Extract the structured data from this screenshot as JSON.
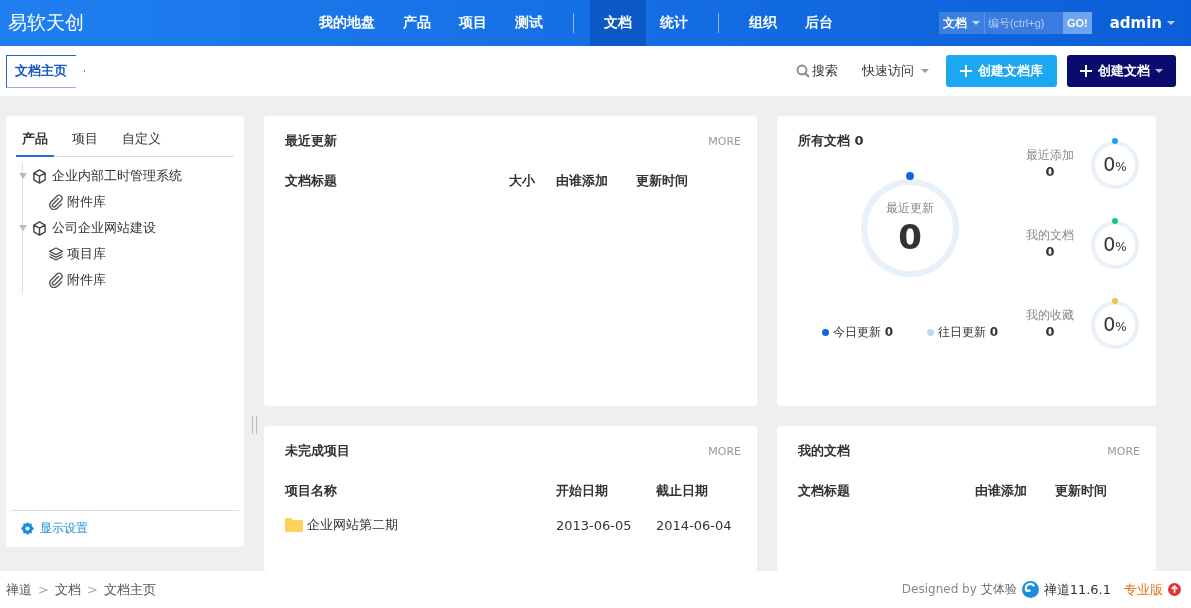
{
  "header": {
    "brand": "易软天创",
    "nav_groups": [
      {
        "items": [
          {
            "label": "我的地盘",
            "selected": false
          },
          {
            "label": "产品",
            "selected": false
          },
          {
            "label": "项目",
            "selected": false
          },
          {
            "label": "测试",
            "selected": false
          }
        ]
      },
      {
        "items": [
          {
            "label": "文档",
            "selected": true
          },
          {
            "label": "统计",
            "selected": false
          }
        ]
      },
      {
        "items": [
          {
            "label": "组织",
            "selected": false
          },
          {
            "label": "后台",
            "selected": false
          }
        ]
      }
    ],
    "search": {
      "type_label": "文档",
      "placeholder": "编号(ctrl+g)",
      "go": "GO!"
    },
    "user": "admin"
  },
  "toolbar": {
    "breadcrumb": "文档主页",
    "search": "搜索",
    "quick_access": "快速访问",
    "buttons": [
      {
        "label": "创建文档库",
        "kind": "secondary"
      },
      {
        "label": "创建文档",
        "kind": "primary"
      }
    ]
  },
  "sidebar": {
    "tabs": [
      {
        "label": "产品",
        "selected": true
      },
      {
        "label": "项目",
        "selected": false
      },
      {
        "label": "自定义",
        "selected": false
      }
    ],
    "tree": [
      {
        "label": "企业内部工时管理系统",
        "kind": "product",
        "expanded": true,
        "children": [
          {
            "label": "附件库",
            "kind": "attachment"
          }
        ]
      },
      {
        "label": "公司企业网站建设",
        "kind": "product",
        "expanded": true,
        "children": [
          {
            "label": "项目库",
            "kind": "project"
          },
          {
            "label": "附件库",
            "kind": "attachment"
          }
        ]
      }
    ],
    "settings": "显示设置"
  },
  "recent": {
    "title": "最近更新",
    "more": "MORE",
    "columns": [
      "文档标题",
      "大小",
      "由谁添加",
      "更新时间"
    ]
  },
  "all_docs": {
    "title": "所有文档 0",
    "main": {
      "label": "最近更新",
      "value": "0",
      "level": 0
    },
    "legend": [
      {
        "label": "今日更新",
        "value": "0",
        "color": "#1565e0"
      },
      {
        "label": "往日更新",
        "value": "0",
        "color": "#c3d8f0"
      }
    ],
    "stats": [
      {
        "label": "最近添加",
        "value": "0",
        "percent": "0",
        "unit": "%",
        "level": 0,
        "color": "#1ea0f0"
      },
      {
        "label": "我的文档",
        "value": "0",
        "percent": "0",
        "unit": "%",
        "level": 0,
        "color": "#10c97a"
      },
      {
        "label": "我的收藏",
        "value": "0",
        "percent": "0",
        "unit": "%",
        "level": 0,
        "color": "#f4c13a"
      }
    ]
  },
  "projects": {
    "title": "未完成项目",
    "more": "MORE",
    "columns": [
      "项目名称",
      "开始日期",
      "截止日期"
    ],
    "rows": [
      {
        "cells": [
          "企业网站第二期",
          "2013-06-05",
          "2014-06-04"
        ]
      }
    ]
  },
  "my_docs": {
    "title": "我的文档",
    "more": "MORE",
    "columns": [
      "文档标题",
      "由谁添加",
      "更新时间"
    ]
  },
  "footer": {
    "breadcrumb": [
      "禅道",
      "文档",
      "文档主页"
    ],
    "separator": ">",
    "designed_by": "Designed by",
    "designer": "艾体验",
    "version": "禅道11.6.1",
    "edition": "专业版"
  }
}
